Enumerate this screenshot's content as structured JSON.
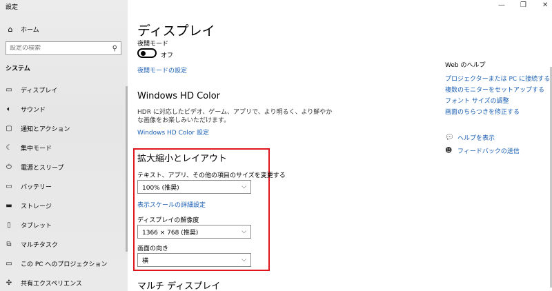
{
  "window": {
    "title": "設定"
  },
  "sidebar": {
    "home": "ホーム",
    "search_placeholder": "設定の検索",
    "section": "システム",
    "items": [
      {
        "label": "ディスプレイ",
        "icon": "monitor-icon"
      },
      {
        "label": "サウンド",
        "icon": "speaker-icon"
      },
      {
        "label": "通知とアクション",
        "icon": "notification-icon"
      },
      {
        "label": "集中モード",
        "icon": "moon-icon"
      },
      {
        "label": "電源とスリープ",
        "icon": "power-icon"
      },
      {
        "label": "バッテリー",
        "icon": "battery-icon"
      },
      {
        "label": "ストレージ",
        "icon": "storage-icon"
      },
      {
        "label": "タブレット",
        "icon": "tablet-icon"
      },
      {
        "label": "マルチタスク",
        "icon": "multitask-icon"
      },
      {
        "label": "この PC へのプロジェクション",
        "icon": "projection-icon"
      },
      {
        "label": "共有エクスペリエンス",
        "icon": "shared-icon"
      }
    ]
  },
  "main": {
    "title": "ディスプレイ",
    "night_mode": {
      "label": "夜間モード",
      "state": "オフ",
      "link": "夜間モードの設定"
    },
    "hd_color": {
      "heading": "Windows HD Color",
      "description": "HDR に対応したビデオ、ゲーム、アプリで、より明るく、より鮮やかな画像をお楽しみいただけます。",
      "link": "Windows HD Color 設定"
    },
    "scale_layout": {
      "heading": "拡大縮小とレイアウト",
      "size_label": "テキスト、アプリ、その他の項目のサイズを変更する",
      "size_value": "100% (推奨)",
      "advanced_link": "表示スケールの詳細設定",
      "resolution_label": "ディスプレイの解像度",
      "resolution_value": "1366 × 768 (推奨)",
      "orientation_label": "画面の向き",
      "orientation_value": "横"
    },
    "multi_display": {
      "heading": "マルチ ディスプレイ"
    }
  },
  "help": {
    "heading": "Web のヘルプ",
    "links": [
      "プロジェクターまたは PC に接続する",
      "複数のモニターをセットアップする",
      "フォント サイズの調整",
      "画面のちらつきを修正する"
    ],
    "get_help": "ヘルプを表示",
    "feedback": "フィードバックの送信"
  },
  "colors": {
    "link": "#1a5fb4",
    "highlight": "#e0141e"
  }
}
